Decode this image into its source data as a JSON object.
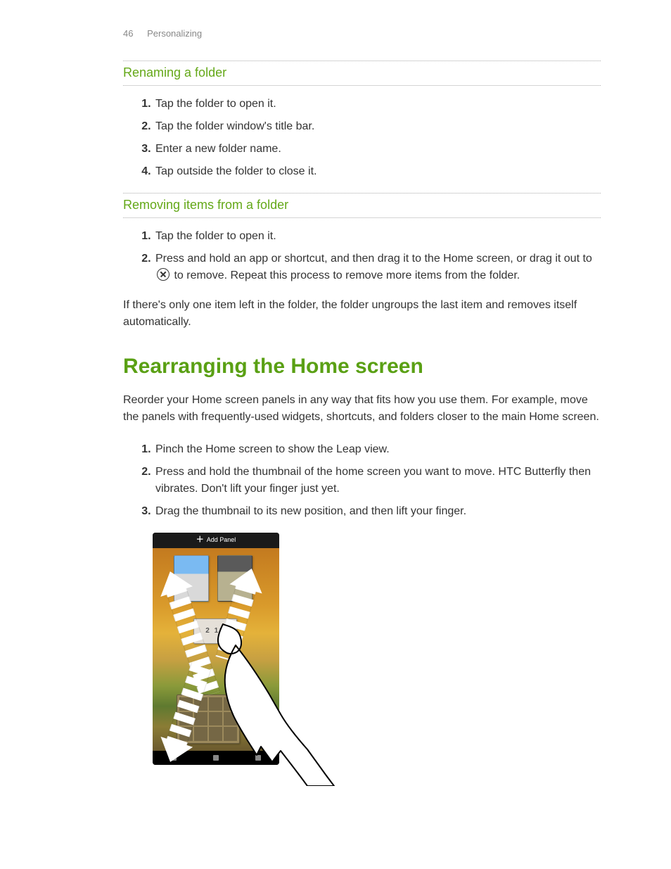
{
  "header": {
    "page_number": "46",
    "chapter": "Personalizing"
  },
  "section1": {
    "title": "Renaming a folder",
    "steps": [
      "Tap the folder to open it.",
      "Tap the folder window's title bar.",
      "Enter a new folder name.",
      "Tap outside the folder to close it."
    ]
  },
  "section2": {
    "title": "Removing items from a folder",
    "steps": [
      "Tap the folder to open it.",
      {
        "pre": "Press and hold an app or shortcut, and then drag it to the Home screen, or drag it out to ",
        "post": " to remove. Repeat this process to remove more items from the folder."
      }
    ],
    "followup": "If there's only one item left in the folder, the folder ungroups the last item and removes itself automatically."
  },
  "section3": {
    "title": "Rearranging the Home screen",
    "intro": "Reorder your Home screen panels in any way that fits how you use them. For example, move the panels with frequently-used widgets, shortcuts, and folders closer to the main Home screen.",
    "steps": [
      "Pinch the Home screen to show the Leap view.",
      "Press and hold the thumbnail of the home screen you want to move. HTC Butterfly then vibrates. Don't lift your finger just yet.",
      "Drag the thumbnail to its new position, and then lift your finger."
    ]
  },
  "illustration": {
    "add_panel_label": "Add Panel",
    "clock_text": "2 13"
  }
}
